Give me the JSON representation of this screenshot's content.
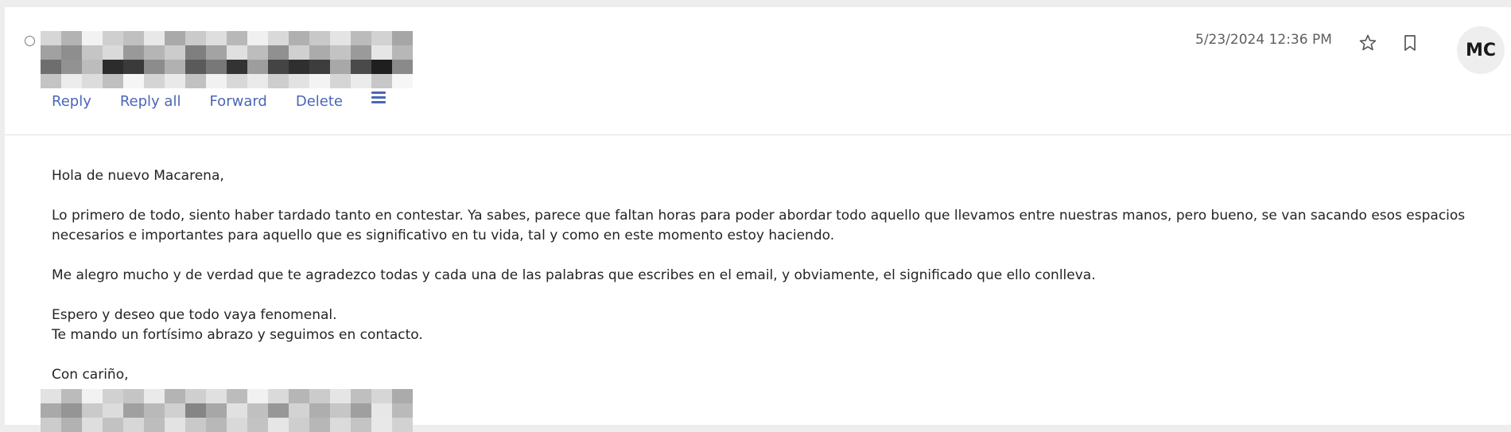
{
  "message": {
    "timestamp": "5/23/2024 12:36 PM",
    "avatar_initials": "MC",
    "sender_redacted": true
  },
  "actions": {
    "reply": "Reply",
    "reply_all": "Reply all",
    "forward": "Forward",
    "delete": "Delete",
    "more_icon": "hamburger-menu-icon"
  },
  "icons": {
    "star": "star-outline-icon",
    "bookmark": "bookmark-outline-icon",
    "select": "radio-circle-icon"
  },
  "colors": {
    "link": "#4b66b8",
    "text": "#242424",
    "muted": "#5e5e5e",
    "avatar_bg": "#eeeeee",
    "background": "#ededed"
  },
  "body": {
    "greeting": "Hola de nuevo Macarena,",
    "paragraph1_line1": "Lo primero de todo, siento haber tardado tanto en contestar. Ya sabes, parece que faltan horas para poder abordar todo aquello que llevamos entre nuestras manos, pero bueno, se van sacando esos espacios",
    "paragraph1_line2": "necesarios e importantes para aquello que es significativo en tu vida, tal y como en este momento estoy haciendo.",
    "paragraph2": "Me alegro mucho y de verdad que te agradezco todas y cada una de las palabras que escribes en el email, y obviamente, el significado que ello conlleva.",
    "paragraph3_line1": "Espero y deseo que todo vaya fenomenal.",
    "paragraph3_line2": "Te mando un fortísimo abrazo y seguimos en contacto.",
    "closing": "Con cariño,"
  }
}
